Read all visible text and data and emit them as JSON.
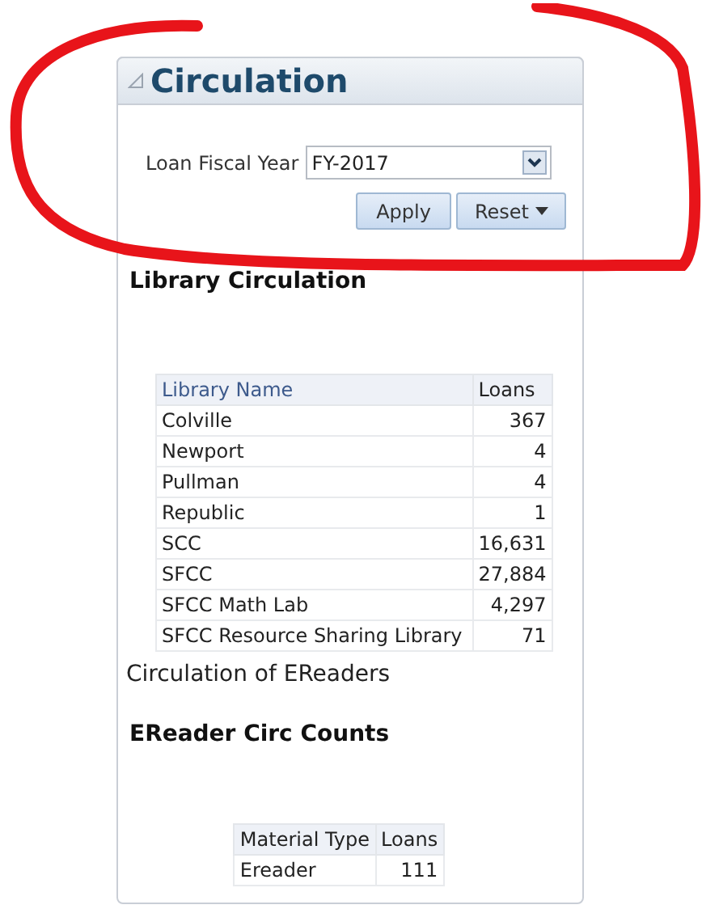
{
  "panel": {
    "title": "Circulation"
  },
  "filter": {
    "label": "Loan Fiscal Year",
    "value": "FY-2017"
  },
  "buttons": [
    {
      "label": "Apply",
      "kind": "plain"
    },
    {
      "label": "Reset",
      "kind": "menu"
    }
  ],
  "sections": [
    {
      "heading": "Library Circulation",
      "caption": "Circulation of EReaders",
      "kind": "wide",
      "table": {
        "columns": [
          "Library Name",
          "Loans"
        ],
        "rows": [
          [
            "Colville",
            "367"
          ],
          [
            "Newport",
            "4"
          ],
          [
            "Pullman",
            "4"
          ],
          [
            "Republic",
            "1"
          ],
          [
            "SCC",
            "16,631"
          ],
          [
            "SFCC",
            "27,884"
          ],
          [
            "SFCC Math Lab",
            "4,297"
          ],
          [
            "SFCC Resource Sharing Library",
            "71"
          ]
        ]
      }
    },
    {
      "heading": "EReader Circ Counts",
      "kind": "narrow",
      "table": {
        "columns": [
          "Material Type",
          "Loans"
        ],
        "rows": [
          [
            "Ereader",
            "111"
          ]
        ]
      }
    }
  ]
}
